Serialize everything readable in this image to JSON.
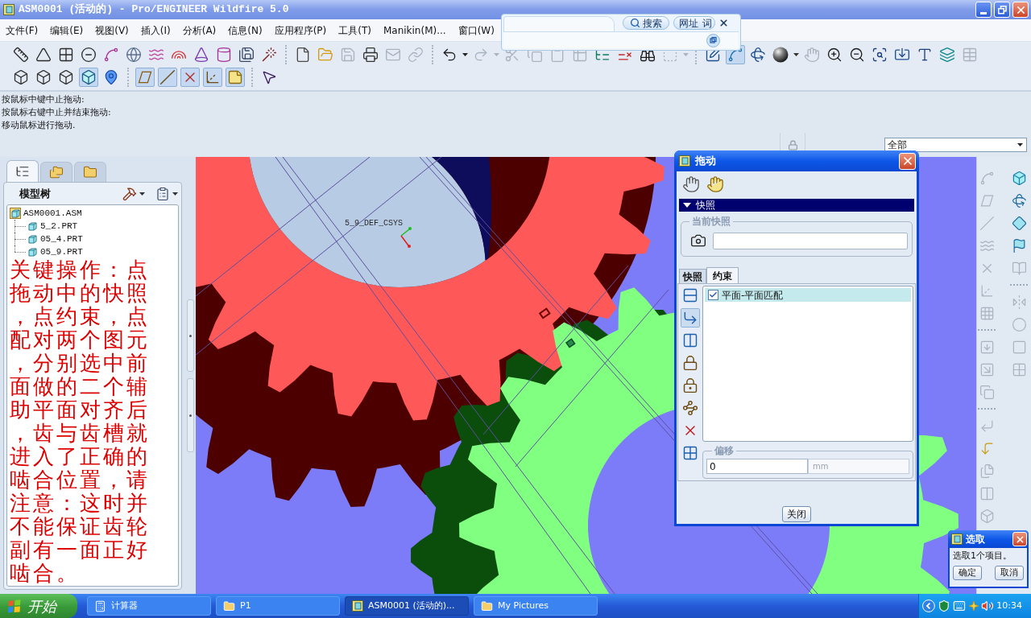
{
  "window": {
    "title": "ASM0001 (活动的) - Pro/ENGINEER Wildfire 5.0"
  },
  "menu_bar": [
    "文件(F)",
    "编辑(E)",
    "视图(V)",
    "插入(I)",
    "分析(A)",
    "信息(N)",
    "应用程序(P)",
    "工具(T)",
    "Manikin(M)...",
    "窗口(W)"
  ],
  "search_toolbar": {
    "buttons": [
      "搜索",
      "网址",
      "词"
    ]
  },
  "toolbar_rows": [
    [
      {
        "buttons": [
          {
            "pressed": false,
            "disabled": false
          },
          {
            "pressed": false,
            "disabled": false
          },
          {
            "pressed": false,
            "disabled": false
          },
          {
            "pressed": false,
            "disabled": false
          },
          {
            "pressed": false,
            "disabled": false
          },
          {
            "pressed": false,
            "disabled": false
          },
          {
            "pressed": false,
            "disabled": false
          },
          {
            "pressed": false,
            "disabled": false
          },
          {
            "pressed": false,
            "disabled": false
          },
          {
            "pressed": false,
            "disabled": false
          },
          {
            "pressed": false,
            "disabled": false
          },
          {
            "pressed": false,
            "disabled": false
          }
        ]
      },
      {
        "buttons": [
          {
            "pressed": false,
            "disabled": false
          },
          {
            "pressed": false,
            "disabled": false
          },
          {
            "pressed": false,
            "disabled": true
          },
          {
            "pressed": false,
            "disabled": false
          },
          {
            "pressed": false,
            "disabled": true
          },
          {
            "pressed": false,
            "disabled": true
          }
        ]
      },
      {
        "buttons": [
          {
            "pressed": false,
            "disabled": false
          },
          {
            "pressed": false,
            "disabled": true
          },
          {
            "pressed": false,
            "disabled": true
          },
          {
            "pressed": false,
            "disabled": true
          },
          {
            "pressed": false,
            "disabled": true
          },
          {
            "pressed": false,
            "disabled": true
          },
          {
            "pressed": false,
            "disabled": false
          },
          {
            "pressed": false,
            "disabled": false
          },
          {
            "pressed": false,
            "disabled": false
          },
          {
            "pressed": false,
            "disabled": true
          }
        ]
      },
      {
        "buttons": [
          {
            "pressed": false,
            "disabled": false
          },
          {
            "pressed": true,
            "disabled": false
          },
          {
            "pressed": false,
            "disabled": false
          },
          {
            "pressed": false,
            "disabled": false
          },
          {
            "pressed": false,
            "disabled": true
          },
          {
            "pressed": false,
            "disabled": false
          },
          {
            "pressed": false,
            "disabled": false
          },
          {
            "pressed": false,
            "disabled": false
          },
          {
            "pressed": false,
            "disabled": false
          },
          {
            "pressed": false,
            "disabled": false
          },
          {
            "pressed": false,
            "disabled": false
          },
          {
            "pressed": false,
            "disabled": true
          }
        ]
      }
    ],
    [
      {
        "buttons": [
          {
            "pressed": false,
            "disabled": false
          },
          {
            "pressed": false,
            "disabled": false
          },
          {
            "pressed": false,
            "disabled": false
          },
          {
            "pressed": true,
            "disabled": false
          },
          {
            "pressed": false,
            "disabled": false
          }
        ]
      },
      {
        "buttons": [
          {
            "pressed": true,
            "disabled": false
          },
          {
            "pressed": true,
            "disabled": false
          },
          {
            "pressed": true,
            "disabled": false
          },
          {
            "pressed": true,
            "disabled": false
          },
          {
            "pressed": true,
            "disabled": false
          }
        ]
      },
      {
        "buttons": [
          {
            "pressed": false,
            "disabled": false
          }
        ]
      }
    ]
  ],
  "messages": [
    "按鼠标中键中止拖动:",
    "按鼠标右键中止并结束拖动:",
    "移动鼠标进行拖动."
  ],
  "filter": {
    "value": "全部"
  },
  "navigator": {
    "tabs": [
      {
        "selected": true
      },
      {
        "selected": false
      },
      {
        "selected": false
      }
    ],
    "title": "模型树",
    "tree": [
      {
        "label": "ASM0001.ASM",
        "children": [
          {
            "label": "5_2.PRT"
          },
          {
            "label": "05_4.PRT"
          },
          {
            "label": "05_9.PRT"
          }
        ]
      }
    ],
    "annotation": "关键操作：点拖动中的快照，点约束，点配对两个图元，分别选中前面做的二个辅助平面对齐后，齿与齿槽就进入了正确的啮合位置，请注意：这时并不能保证齿轮副有一面正好啮合。"
  },
  "graphics": {
    "csys_label": "5_9_DEF_CSYS"
  },
  "right_toolbar": [
    [
      {
        "buttons": [
          {
            "disabled": true
          },
          {
            "disabled": true
          },
          {
            "disabled": true
          },
          {
            "disabled": true
          },
          {
            "disabled": true
          },
          {
            "disabled": true
          },
          {
            "disabled": true
          }
        ]
      },
      {
        "buttons": [
          {
            "disabled": true
          },
          {
            "disabled": true
          },
          {
            "disabled": true
          }
        ]
      },
      {
        "buttons": [
          {
            "disabled": true
          },
          {
            "disabled": false
          },
          {
            "disabled": true
          },
          {
            "disabled": true
          },
          {
            "disabled": true
          }
        ]
      }
    ],
    [
      {
        "buttons": [
          {
            "disabled": false
          },
          {
            "disabled": false
          },
          {
            "disabled": false
          },
          {
            "disabled": false
          },
          {
            "disabled": true
          }
        ]
      },
      {
        "buttons": [
          {
            "disabled": true
          },
          {
            "disabled": true
          },
          {
            "disabled": true
          },
          {
            "disabled": true
          }
        ]
      }
    ]
  ],
  "drag_dialog": {
    "title": "拖动",
    "section": {
      "title": "快照",
      "expanded": true
    },
    "current_snapshot": {
      "label": "当前快照"
    },
    "tabs": [
      {
        "label": "快照",
        "selected": false
      },
      {
        "label": "约束",
        "selected": true
      }
    ],
    "tool_buttons": [
      {
        "selected": false
      },
      {
        "selected": true
      },
      {
        "selected": false
      },
      {
        "selected": false
      },
      {
        "selected": false
      },
      {
        "selected": false
      },
      {
        "selected": false
      },
      {
        "selected": false
      }
    ],
    "constraints": [
      {
        "label": "平面-平面匹配",
        "checked": true,
        "selected": true
      }
    ],
    "offset": {
      "label": "偏移",
      "value": "0",
      "unit": "mm",
      "unit_disabled": true
    },
    "close_button": "关闭"
  },
  "select_dialog": {
    "title": "选取",
    "message": "选取1个项目。",
    "buttons": [
      "确定",
      "取消"
    ]
  },
  "taskbar": {
    "start_button": "开始",
    "tasks": [
      {
        "kind": "calculator",
        "label": "计算器",
        "selected": false
      },
      {
        "kind": "folder",
        "label": "P1",
        "selected": false
      },
      {
        "kind": "app",
        "label": "ASM0001 (活动的)...",
        "selected": true
      },
      {
        "kind": "folder",
        "label": "My Pictures",
        "selected": false
      }
    ],
    "clock": "10:34"
  }
}
